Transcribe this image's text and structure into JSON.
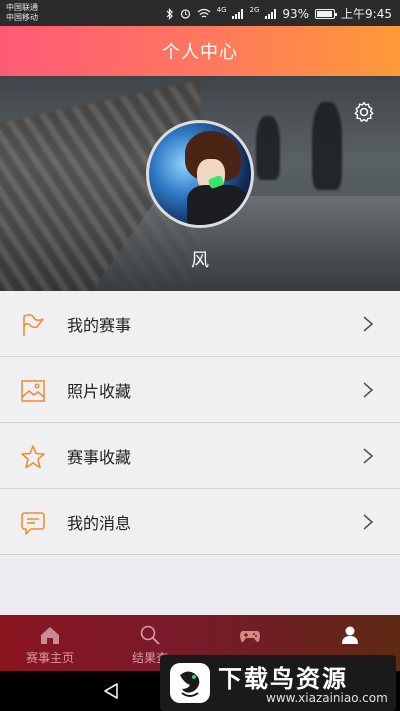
{
  "status_bar": {
    "carrier_1": "中国联通",
    "carrier_2": "中国移动",
    "network_1": "4G",
    "network_2": "2G",
    "battery": "93%",
    "battery_level": 0.93,
    "time": "上午9:45"
  },
  "header": {
    "title": "个人中心"
  },
  "profile": {
    "username": "风",
    "settings_icon": "gear-icon",
    "avatar_icon": "avatar"
  },
  "menu": {
    "items": [
      {
        "label": "我的赛事",
        "icon": "flag-icon",
        "color": "#f08a2e"
      },
      {
        "label": "照片收藏",
        "icon": "image-icon",
        "color": "#f08a2e"
      },
      {
        "label": "赛事收藏",
        "icon": "star-icon",
        "color": "#f08a2e"
      },
      {
        "label": "我的消息",
        "icon": "message-icon",
        "color": "#f08a2e"
      }
    ]
  },
  "tab_bar": {
    "tabs": [
      {
        "label": "赛事主页",
        "icon": "home-icon",
        "active": false
      },
      {
        "label": "结果查",
        "icon": "search-icon",
        "active": false
      },
      {
        "label": "",
        "icon": "gamepad-icon",
        "active": false
      },
      {
        "label": "",
        "icon": "person-icon",
        "active": true
      }
    ]
  },
  "watermark": {
    "brand": "下载鸟资源",
    "url": "www.xiazainiao.com"
  },
  "colors": {
    "accent_start": "#ff5a77",
    "accent_end": "#ff9a38",
    "icon_orange": "#f08a2e",
    "tabbar": "#7a1a2a"
  }
}
